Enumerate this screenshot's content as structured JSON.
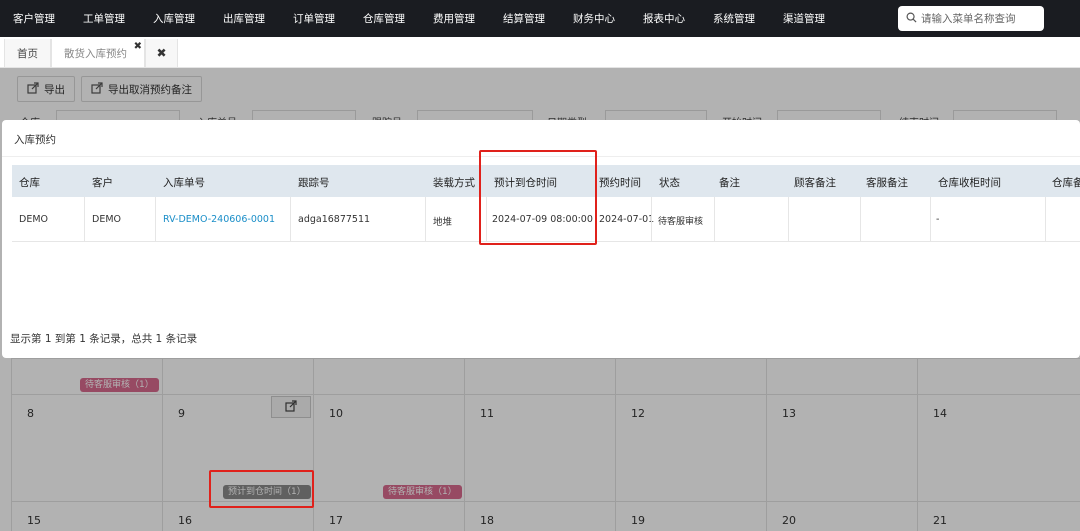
{
  "top_nav": {
    "menu": [
      "客户管理",
      "工单管理",
      "入库管理",
      "出库管理",
      "订单管理",
      "仓库管理",
      "费用管理",
      "结算管理",
      "财务中心",
      "报表中心",
      "系统管理",
      "渠道管理"
    ],
    "search_placeholder": "请输入菜单名称查询"
  },
  "tabs": {
    "home": "首页",
    "active": "散货入库预约",
    "close_glyph": "✖"
  },
  "toolbar": {
    "export_label": "导出",
    "export_cancel_label": "导出取消预约备注"
  },
  "filters": {
    "warehouse": "仓库",
    "inbound_no": "入库单号",
    "tracking_no": "跟踪号",
    "date_type": "日期类型",
    "start_time": "开始时间",
    "end_time": "结束时间"
  },
  "modal": {
    "title": "入库预约",
    "columns": [
      "仓库",
      "客户",
      "入库单号",
      "跟踪号",
      "装载方式",
      "预计到仓时间",
      "预约时间",
      "状态",
      "备注",
      "顾客备注",
      "客服备注",
      "仓库收柜时间",
      "仓库备"
    ],
    "row": {
      "warehouse": "DEMO",
      "customer": "DEMO",
      "inbound_no": "RV-DEMO-240606-0001",
      "tracking_no": "adga16877511",
      "load_method": "地堆",
      "eta": "2024-07-09 08:00:00",
      "booking_time": "2024-07-01",
      "status": "待客服审核",
      "remark": "",
      "customer_remark": "",
      "cs_remark": "",
      "receive_time": "-",
      "wh_remark": ""
    },
    "footer": "显示第 1 到第 1 条记录，总共 1 条记录"
  },
  "calendar": {
    "row1_badge": "待客服审核（1）",
    "week2_days": [
      "8",
      "9",
      "10",
      "11",
      "12",
      "13",
      "14"
    ],
    "week3_days": [
      "15",
      "16",
      "17",
      "18",
      "19",
      "20",
      "21"
    ],
    "eta_badge": "预计到仓时间（1）",
    "pending_badge": "待客服审核（1）"
  },
  "colors": {
    "nav_bg": "#1a1c21",
    "header_row_bg": "#dfe7ee",
    "link": "#1a8ec8",
    "highlight": "#e0211b",
    "badge_pink": "#d86a8e"
  }
}
